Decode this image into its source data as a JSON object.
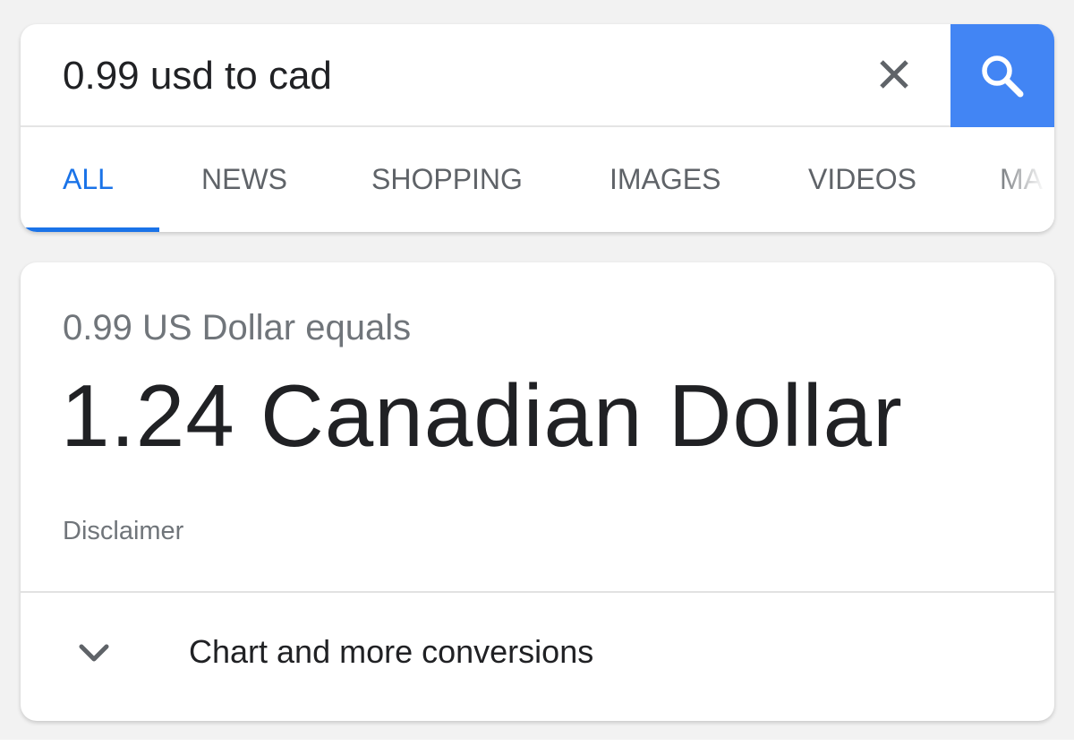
{
  "search": {
    "query": "0.99 usd to cad",
    "clear_icon": "close-icon",
    "search_icon": "search-icon",
    "accent": "#4285f4"
  },
  "tabs": [
    {
      "label": "ALL",
      "active": true
    },
    {
      "label": "NEWS",
      "active": false
    },
    {
      "label": "SHOPPING",
      "active": false
    },
    {
      "label": "IMAGES",
      "active": false
    },
    {
      "label": "VIDEOS",
      "active": false
    },
    {
      "label": "MA",
      "active": false
    }
  ],
  "colors": {
    "active_tab": "#1a73e8",
    "inactive_tab": "#5f6368",
    "primary_text": "#202124",
    "secondary_text": "#70757a"
  },
  "converter": {
    "from_line": "0.99 US Dollar equals",
    "result_line": "1.24 Canadian Dollar",
    "disclaimer": "Disclaimer",
    "expand_icon": "chevron-down-icon",
    "expand_label": "Chart and more conversions"
  }
}
